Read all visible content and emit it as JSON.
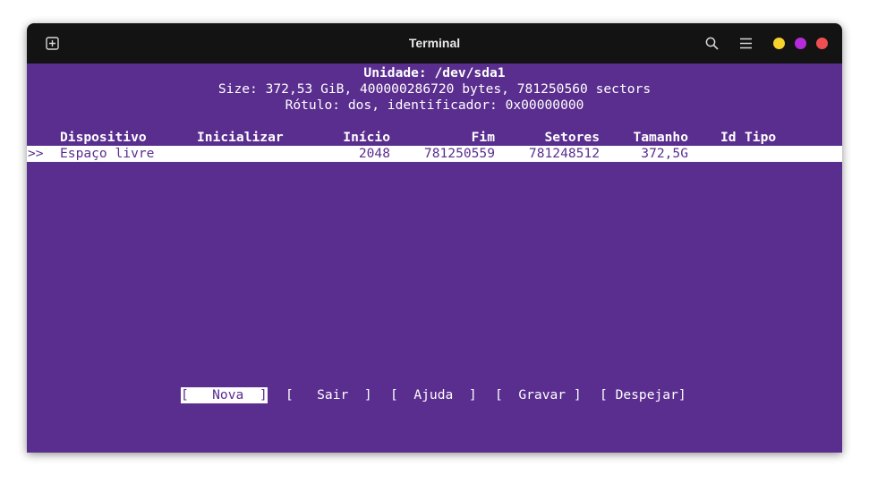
{
  "window": {
    "title": "Terminal",
    "controls_colors": {
      "minimize": "#f6d32d",
      "maximize": "#b42cd9",
      "close": "#ef4f52"
    },
    "background": "#5a2e8f"
  },
  "disk": {
    "unit_line": "Unidade: /dev/sda1",
    "size_line": "Size: 372,53 GiB, 400000286720 bytes, 781250560 sectors",
    "label_line": "Rótulo: dos, identificador: 0x00000000"
  },
  "table": {
    "headers": {
      "device": "Dispositivo",
      "boot": "Inicializar",
      "start": "Início",
      "end": "Fim",
      "sectors": "Setores",
      "size": "Tamanho",
      "id": "Id",
      "type": "Tipo"
    },
    "rows": [
      {
        "marker": ">>",
        "device": "Espaço livre",
        "boot": "",
        "start": "2048",
        "end": "781250559",
        "sectors": "781248512",
        "size": "372,5G",
        "id": "",
        "type": ""
      }
    ]
  },
  "actions": [
    {
      "label": "[   Nova  ]",
      "selected": true
    },
    {
      "label": "[   Sair  ]",
      "selected": false
    },
    {
      "label": "[  Ajuda  ]",
      "selected": false
    },
    {
      "label": "[  Gravar ]",
      "selected": false
    },
    {
      "label": "[ Despejar]",
      "selected": false
    }
  ]
}
